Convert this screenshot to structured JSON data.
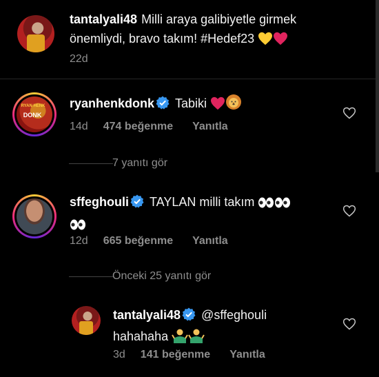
{
  "caption": {
    "username": "tantalyali48",
    "text": "Milli araya galibiyetle girmek önemliydi, bravo takım! #Hedef23",
    "time": "22d"
  },
  "comments": [
    {
      "username": "ryanhenkdonk",
      "text": "Tabiki",
      "time": "14d",
      "likes": "474 beğenme",
      "reply": "Yanıtla",
      "avatar_label": "DONK",
      "avatar_sub": "RYAN HENK",
      "view_replies": "7 yanıtı gör"
    },
    {
      "username": "sffeghouli",
      "text": "TAYLAN milli takım",
      "time": "12d",
      "likes": "665 beğenme",
      "reply": "Yanıtla",
      "view_replies": "Önceki 25 yanıtı gör"
    }
  ],
  "reply": {
    "username": "tantalyali48",
    "mention": "@sffeghouli",
    "text": "hahahaha",
    "time": "3d",
    "likes": "141 beğenme",
    "reply": "Yanıtla"
  },
  "colors": {
    "background": "#000000",
    "muted": "#8e8e8e",
    "verified": "#3897f0",
    "heart_red": "#e0245e",
    "heart_yellow": "#ffcc33"
  }
}
